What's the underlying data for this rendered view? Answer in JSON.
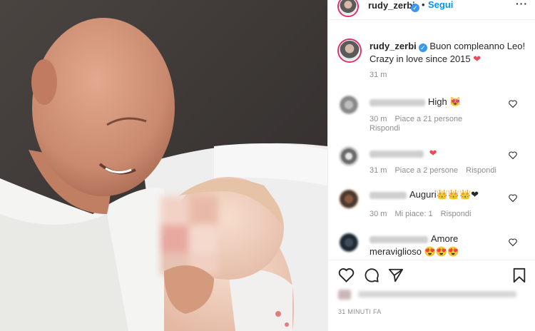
{
  "header": {
    "username": "rudy_zerbi",
    "verified_mark": "✓",
    "separator": "•",
    "follow_label": "Segui",
    "more_label": "···"
  },
  "caption": {
    "username": "rudy_zerbi",
    "text": "Buon compleanno Leo! Crazy in love since 2015",
    "emoji": "❤",
    "time": "31 m"
  },
  "comments": [
    {
      "text": "High",
      "emoji": "😻",
      "time": "30 m",
      "likes": "Piace a 21 persone",
      "reply": "Rispondi"
    },
    {
      "text": "",
      "emoji": "❤",
      "time": "31 m",
      "likes": "Piace a 2 persone",
      "reply": "Rispondi"
    },
    {
      "text": "Auguri",
      "emoji": "👑👑👑❤",
      "time": "30 m",
      "likes": "Mi piace: 1",
      "reply": "Rispondi"
    },
    {
      "text": "Amore meraviglioso",
      "emoji": "😍😍😍"
    }
  ],
  "footer": {
    "date": "31 MINUTI FA"
  },
  "icons": {
    "like": "heart-icon",
    "comment": "comment-icon",
    "share": "share-icon",
    "save": "bookmark-icon",
    "more": "more-icon",
    "comment_like": "heart-outline-icon"
  },
  "colors": {
    "accent": "#0095f6",
    "verified": "#3897f0",
    "heart": "#ed4956",
    "muted": "#8e8e8e"
  }
}
